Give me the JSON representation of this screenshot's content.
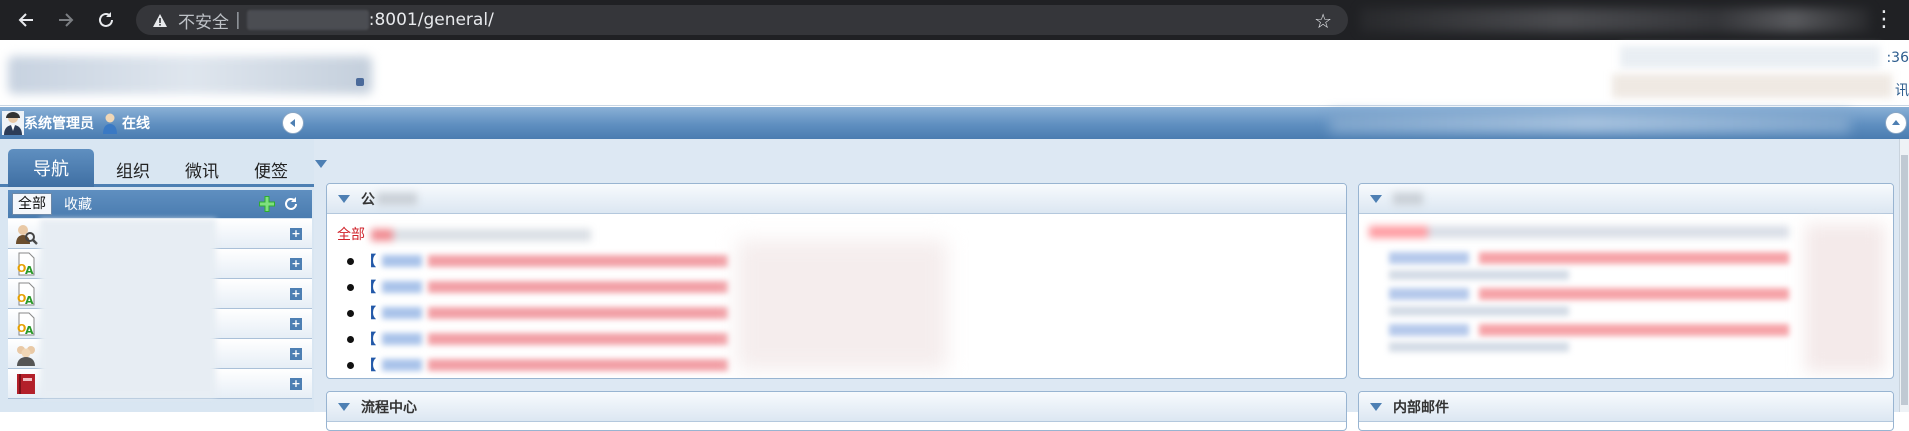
{
  "browser": {
    "security_label": "不安全",
    "separator": "|",
    "url_path": ":8001/general/"
  },
  "header": {
    "time_fragment": ":36",
    "msg_fragment": "讯"
  },
  "statusbar": {
    "user_name": "系统管理员",
    "online_label": "在线"
  },
  "sidebar": {
    "tabs": [
      {
        "label": "导航",
        "active": true
      },
      {
        "label": "组织"
      },
      {
        "label": "微讯"
      },
      {
        "label": "便签"
      }
    ],
    "filter_all": "全部",
    "filter_fav": "收藏",
    "menu_items": [
      {
        "icon": "user-search-icon"
      },
      {
        "icon": "oa-document-icon"
      },
      {
        "icon": "oa-document-icon"
      },
      {
        "icon": "oa-document-icon"
      },
      {
        "icon": "people-icon"
      },
      {
        "icon": "book-icon"
      }
    ]
  },
  "portlets": {
    "notice": {
      "title": "公",
      "category_all": "全部",
      "item_prefix": "【"
    },
    "workflow": {
      "title": "流程中心"
    },
    "mail": {
      "title": "内部邮件"
    }
  },
  "colors": {
    "chrome_bg": "#202124",
    "accent_blue": "#4d7fb3",
    "notice_red": "#d0222a"
  }
}
